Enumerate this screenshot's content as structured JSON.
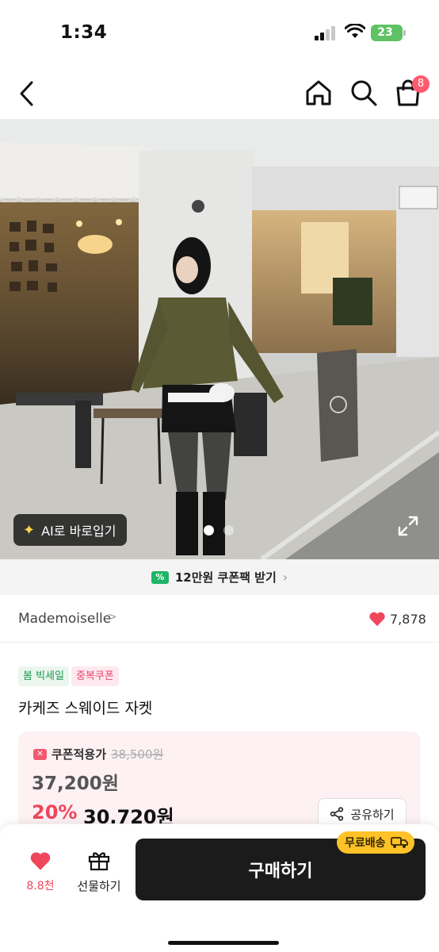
{
  "status_bar": {
    "time": "1:34",
    "battery": "23"
  },
  "nav": {
    "cart_count": "8"
  },
  "gallery": {
    "ai_button_label": "AI로 바로입기"
  },
  "coupon_pack": {
    "label": "12만원 쿠폰팩 받기"
  },
  "brand": {
    "name": "Mademoiselle",
    "chevron": ">",
    "likes": "7,878"
  },
  "tags": [
    "봄 빅세일",
    "중복쿠폰"
  ],
  "product": {
    "title": "카케즈 스웨이드 자켓"
  },
  "price": {
    "coupon_label": "쿠폰적용가",
    "original": "38,500원",
    "base": "37,200원",
    "discount": "20%",
    "final": "30,720원"
  },
  "share": {
    "label": "공유하기"
  },
  "bottom": {
    "like_count": "8.8천",
    "gift_label": "선물하기",
    "buy_label": "구매하기",
    "free_shipping": "무료배송"
  },
  "colors": {
    "accent_red": "#f0465c",
    "green": "#1fb467",
    "buy_bg": "#1b1b1b",
    "badge_yellow": "#ffc228"
  }
}
